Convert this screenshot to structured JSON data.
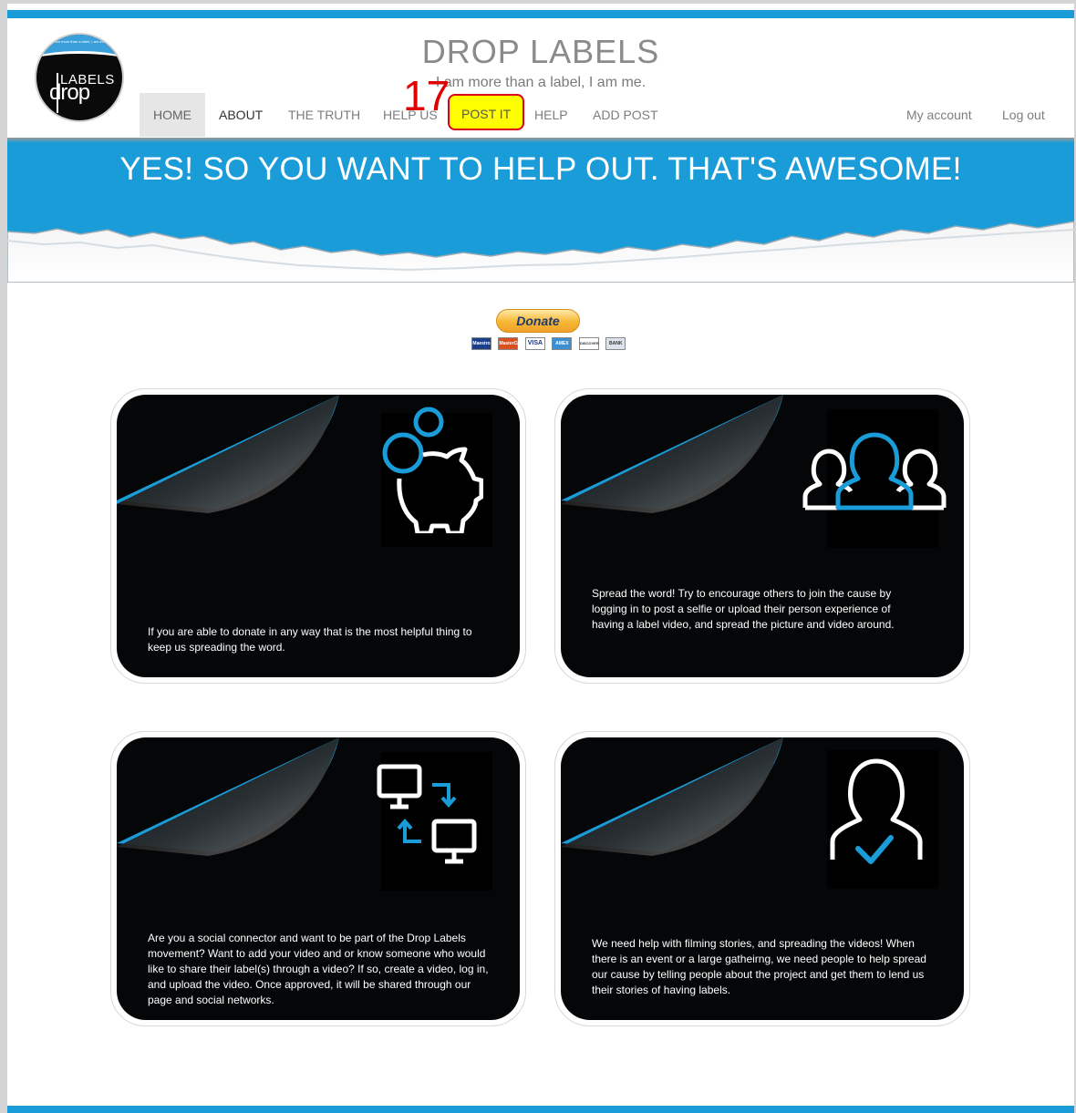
{
  "site": {
    "title": "DROP LABELS",
    "tagline": "I am more than a label, I am me.",
    "logo": {
      "tagline": "I am more than a label, I am me.",
      "word_top": "LABELS",
      "word_bottom": "drop"
    }
  },
  "nav": {
    "items": [
      {
        "label": "HOME",
        "active": true
      },
      {
        "label": "ABOUT"
      },
      {
        "label": "THE TRUTH"
      },
      {
        "label": "HELP US"
      },
      {
        "label": "POST IT",
        "highlighted": true
      },
      {
        "label": "HELP"
      },
      {
        "label": "ADD POST"
      }
    ],
    "account": {
      "my_account": "My account",
      "log_out": "Log out"
    },
    "marker_number": "17"
  },
  "hero": {
    "title": "YES! SO YOU WANT TO HELP OUT. THAT'S AWESOME!"
  },
  "donate": {
    "button_label": "Donate",
    "cards": [
      "Maestro",
      "MasterCard",
      "VISA",
      "AMEX",
      "DISCOVER",
      "BANK"
    ]
  },
  "features": [
    {
      "icon": "piggy-bank-icon",
      "text": "If you are able to donate in any way that is the most helpful thing to keep us spreading the word."
    },
    {
      "icon": "people-group-icon",
      "text": "Spread the word! Try to encourage others to join the cause by logging in to post a selfie or upload their person experience of having a label video, and spread the picture and video around."
    },
    {
      "icon": "computer-transfer-icon",
      "text": "Are you a social connector and want to be part of the Drop Labels movement? Want to add your video and or know someone who would like to share their label(s) through a video? If so, create a video, log in, and upload the video. Once approved, it will be shared through our page and social networks."
    },
    {
      "icon": "person-check-icon",
      "text": "We need help with filming stories, and spreading the videos! When there is an event or a large gatheirng, we need people to help spread our cause by telling people about the project and get them to lend us their stories of having labels."
    }
  ],
  "colors": {
    "accent": "#1a9cd8",
    "highlight": "#ffff00",
    "marker": "#e00000",
    "card_bg": "#040608"
  }
}
